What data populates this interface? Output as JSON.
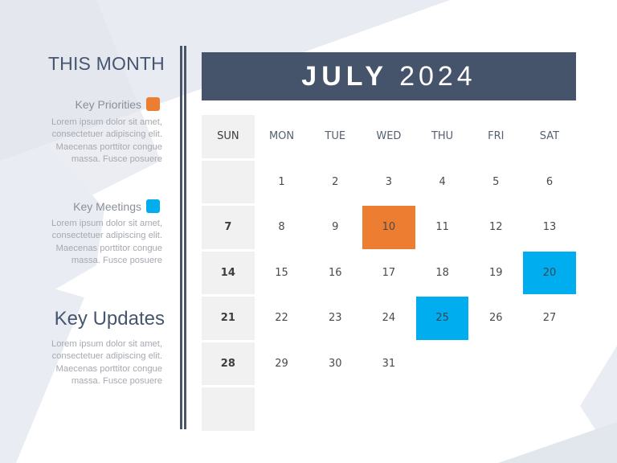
{
  "sidebar": {
    "title": "THIS MONTH",
    "sections": [
      {
        "label": "Key Priorities",
        "color": "#ed7d31",
        "lines": [
          "Lorem ipsum dolor sit amet,",
          "consectetuer adipiscing elit.",
          "Maecenas porttitor congue",
          "massa. Fusce posuere"
        ]
      },
      {
        "label": "Key Meetings",
        "color": "#00aeef",
        "lines": [
          "Lorem ipsum dolor sit amet,",
          "consectetuer adipiscing elit.",
          "Maecenas porttitor congue",
          "massa. Fusce posuere"
        ]
      }
    ],
    "updates": {
      "title": "Key Updates",
      "lines": [
        "Lorem ipsum dolor sit amet,",
        "consectetuer adipiscing elit.",
        "Maecenas porttitor congue",
        "massa. Fusce posuere"
      ]
    }
  },
  "calendar": {
    "month": "JULY",
    "year": "2024",
    "weekdays": [
      "SUN",
      "MON",
      "TUE",
      "WED",
      "THU",
      "FRI",
      "SAT"
    ],
    "weeks": [
      [
        "",
        "1",
        "2",
        "3",
        "4",
        "5",
        "6"
      ],
      [
        "7",
        "8",
        "9",
        "10",
        "11",
        "12",
        "13"
      ],
      [
        "14",
        "15",
        "16",
        "17",
        "18",
        "19",
        "20"
      ],
      [
        "21",
        "22",
        "23",
        "24",
        "25",
        "26",
        "27"
      ],
      [
        "28",
        "29",
        "30",
        "31",
        "",
        "",
        ""
      ],
      [
        "",
        "",
        "",
        "",
        "",
        "",
        ""
      ]
    ],
    "highlights": {
      "10": "priority",
      "20": "meeting",
      "25": "meeting"
    }
  },
  "colors": {
    "header_bg": "#45546b",
    "priority": "#ed7d31",
    "meeting": "#00aeef",
    "sunday_bg": "#f1f1f1",
    "title_text": "#465670"
  }
}
